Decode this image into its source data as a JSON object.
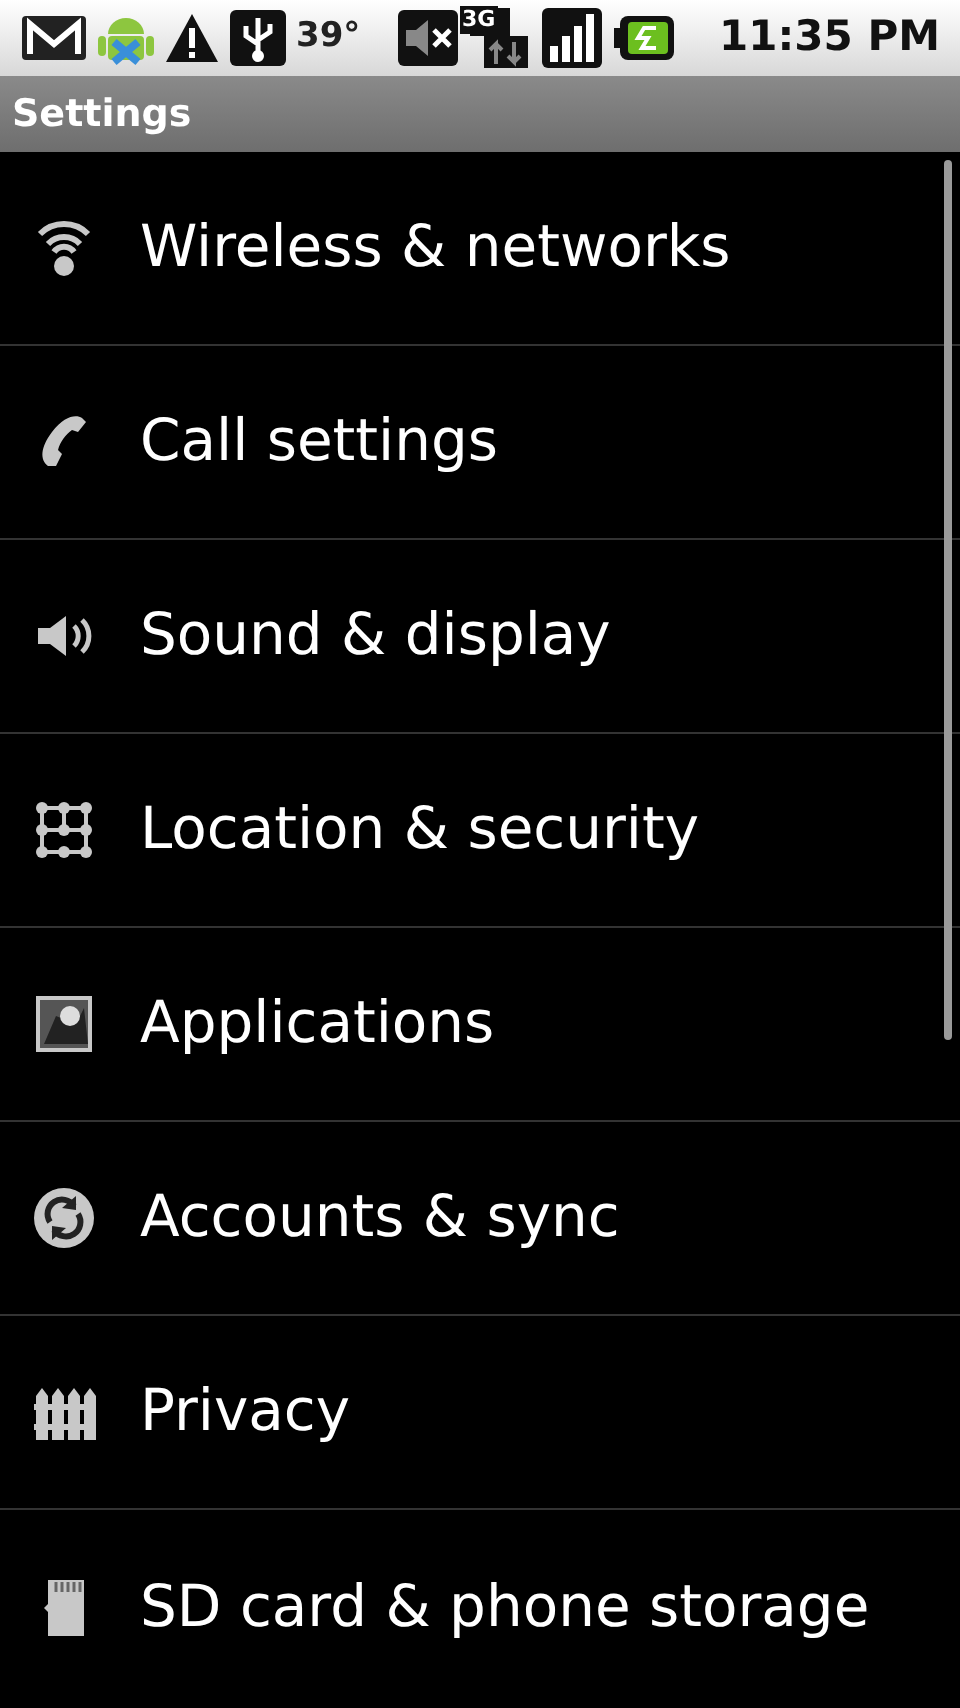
{
  "status_bar": {
    "temperature": "39°",
    "network_type": "3G",
    "time": "11:35 PM"
  },
  "title_bar": {
    "title": "Settings"
  },
  "settings": [
    {
      "kind": "wireless",
      "label": "Wireless & networks"
    },
    {
      "kind": "call",
      "label": "Call settings"
    },
    {
      "kind": "sound",
      "label": "Sound & display"
    },
    {
      "kind": "location",
      "label": "Location & security"
    },
    {
      "kind": "applications",
      "label": "Applications"
    },
    {
      "kind": "accounts",
      "label": "Accounts & sync"
    },
    {
      "kind": "privacy",
      "label": "Privacy"
    },
    {
      "kind": "storage",
      "label": "SD card & phone storage"
    }
  ]
}
